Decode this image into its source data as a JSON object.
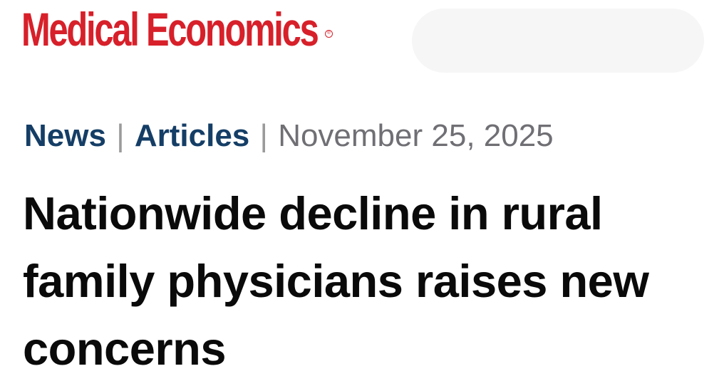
{
  "header": {
    "logo_text": "Medical Economics",
    "logo_mark": "®",
    "brand_color": "#d7202a"
  },
  "article": {
    "category_primary": "News",
    "separator": "|",
    "category_secondary": "Articles",
    "date": "November 25, 2025",
    "title": "Nationwide decline in rural family physicians raises new concerns",
    "category_color": "#153e66"
  }
}
